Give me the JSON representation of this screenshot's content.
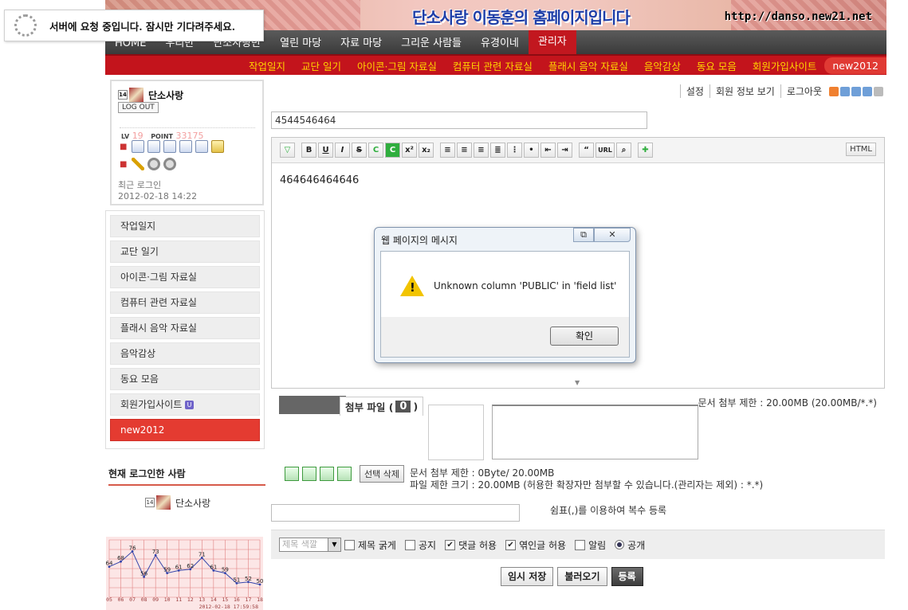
{
  "banner": {
    "title": "단소사랑 이동훈의 홈페이지입니다",
    "url": "http://danso.new21.net"
  },
  "toast": {
    "message": "서버에 요청 중입니다. 잠시만 기다려주세요."
  },
  "main_nav": [
    "HOME",
    "우리반",
    "단소사랑반",
    "열린 마당",
    "자료 마당",
    "그리운 사람들",
    "유경이네",
    "관리자"
  ],
  "sub_nav": [
    "작업일지",
    "교단 일기",
    "아이콘·그림 자료실",
    "컴퓨터 관련 자료실",
    "플래시 음악 자료실",
    "음악감상",
    "동요 모음",
    "회원가입사이트",
    "new2012"
  ],
  "login": {
    "level_badge": "14",
    "username": "단소사랑",
    "logout_label": "LOG OUT",
    "lv_label": "LV",
    "lv_value": "19",
    "point_label": "POINT",
    "point_value": "33175",
    "recent_label": "최근 로그인",
    "recent_time": "2012-02-18 14:22"
  },
  "side_menu": [
    "작업일지",
    "교단 일기",
    "아이콘·그림 자료실",
    "컴퓨터 관련 자료실",
    "플래시 음악 자료실",
    "음악감상",
    "동요 모음",
    "회원가입사이트",
    "new2012"
  ],
  "side_menu_badge": "U",
  "online": {
    "title": "현재 로그인한 사람",
    "badge": "14",
    "user": "단소사랑"
  },
  "top_links": [
    "설정",
    "회원 정보 보기",
    "로그아웃"
  ],
  "skin_colors": [
    "#f08030",
    "#6f9fd8",
    "#6f9fd8",
    "#6f9fd8",
    "#bbbbbb"
  ],
  "editor": {
    "title_value": "4544546464",
    "body_text": "464646464646",
    "html_label": "HTML",
    "url_label": "URL",
    "quote_label": "“"
  },
  "dialog": {
    "title": "웹 페이지의 메시지",
    "message": "Unknown column 'PUBLIC' in 'field list'",
    "ok_label": "확인"
  },
  "attach": {
    "label": "첨부 파일 (",
    "count": "0",
    "close": ")",
    "limit": "문서 첨부 제한 : 20.00MB (20.00MB/*.*)",
    "delete_label": "선택 삭제",
    "info1": "문서 첨부 제한 : 0Byte/ 20.00MB",
    "info2": "파일 제한 크기 : 20.00MB (허용한 확장자만 첨부할 수 있습니다.(관리자는 제외) : *.*)"
  },
  "tag_hint": "쉼표(,)를 이용하여 복수 등록",
  "options": {
    "color_select": "제목 색깔",
    "items": [
      {
        "label": "제목 굵게",
        "checked": false
      },
      {
        "label": "공지",
        "checked": false
      },
      {
        "label": "댓글 허용",
        "checked": true
      },
      {
        "label": "엮인글 허용",
        "checked": true
      },
      {
        "label": "알림",
        "checked": false
      }
    ],
    "public_label": "공개"
  },
  "actions": [
    "임시 저장",
    "불러오기",
    "등록"
  ],
  "chart_data": {
    "type": "line",
    "categories": [
      "05",
      "06",
      "07",
      "08",
      "09",
      "10",
      "11",
      "12",
      "13",
      "14",
      "15",
      "16",
      "17",
      "18"
    ],
    "values": [
      64,
      68,
      76,
      56,
      73,
      59,
      61,
      62,
      71,
      61,
      59,
      51,
      52,
      50
    ],
    "timestamp": "2012-02-18 17:59:58",
    "ylim": [
      40,
      85
    ],
    "grid": true,
    "line_color": "#3344aa",
    "bg_color": "#fce6e6",
    "grid_color": "#e08080"
  }
}
